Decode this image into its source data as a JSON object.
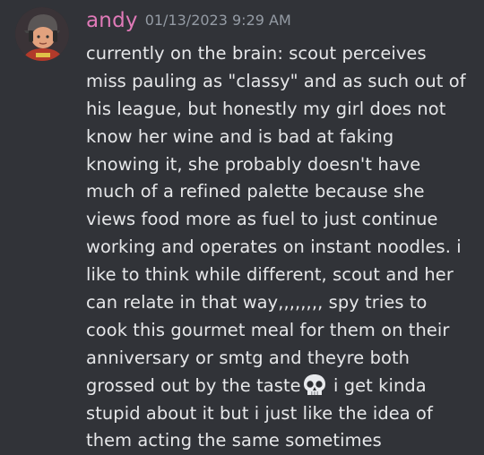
{
  "message": {
    "author": "andy",
    "timestamp": "01/13/2023 9:29 AM",
    "author_color": "#e07ab8",
    "lines_before_emoji": [
      "currently on the brain: scout perceives",
      "miss pauling as \"classy\" and as such out of",
      "his league, but honestly my girl does not",
      "know her wine and is bad at faking",
      "knowing it, she probably doesn't have",
      "much of a refined palette because she",
      "views food more as fuel to just continue",
      "working and operates on instant noodles. i",
      "like to think while different, scout and her",
      "can relate in that way,,,,,,,, spy tries to",
      "cook this gourmet meal for them on their",
      "anniversary or smtg and theyre both"
    ],
    "emoji_line_before": "grossed out by the taste",
    "emoji": "skull-emoji",
    "emoji_line_after": " i get kinda",
    "lines_after_emoji": [
      "stupid about it but i just like the idea of",
      "them acting the same sometimes"
    ]
  }
}
